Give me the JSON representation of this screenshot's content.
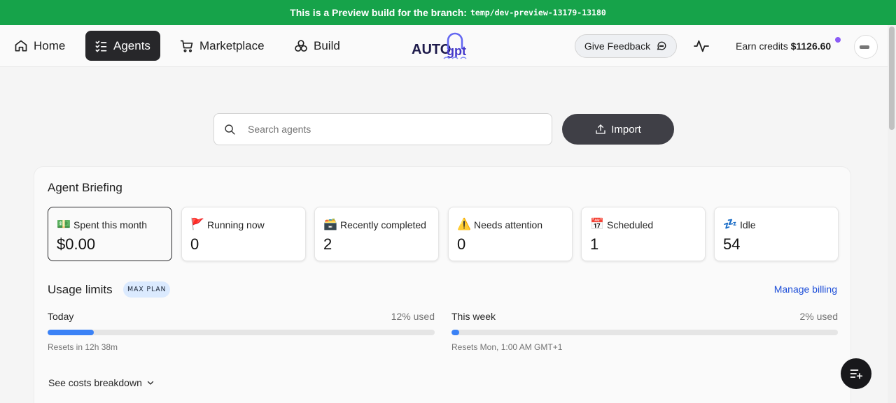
{
  "banner": {
    "text": "This is a Preview build for the branch:",
    "branch": "temp/dev-preview-13179-13180"
  },
  "nav": {
    "items": [
      {
        "label": "Home",
        "icon": "home-icon",
        "active": false
      },
      {
        "label": "Agents",
        "icon": "list-check-icon",
        "active": true
      },
      {
        "label": "Marketplace",
        "icon": "cart-icon",
        "active": false
      },
      {
        "label": "Build",
        "icon": "cubes-icon",
        "active": false
      }
    ],
    "logo_alt": "AutoGPT",
    "feedback_label": "Give Feedback",
    "credits_label": "Earn credits",
    "credits_value": "$1126.60"
  },
  "search": {
    "placeholder": "Search agents",
    "value": ""
  },
  "import_label": "Import",
  "briefing": {
    "title": "Agent Briefing",
    "stats": [
      {
        "emoji": "💵",
        "label": "Spent this month",
        "value": "$0.00"
      },
      {
        "emoji": "🚩",
        "label": "Running now",
        "value": "0"
      },
      {
        "emoji": "🗃️",
        "label": "Recently completed",
        "value": "2"
      },
      {
        "emoji": "⚠️",
        "label": "Needs attention",
        "value": "0"
      },
      {
        "emoji": "📅",
        "label": "Scheduled",
        "value": "1"
      },
      {
        "emoji": "💤",
        "label": "Idle",
        "value": "54"
      }
    ]
  },
  "usage": {
    "title": "Usage limits",
    "plan": "MAX PLAN",
    "manage_billing": "Manage billing",
    "limits": [
      {
        "label": "Today",
        "used": "12% used",
        "fraction": 0.12,
        "reset": "Resets in 12h 38m"
      },
      {
        "label": "This week",
        "used": "2% used",
        "fraction": 0.02,
        "reset": "Resets Mon, 1:00 AM GMT+1"
      }
    ]
  },
  "costs_breakdown": "See costs breakdown",
  "colors": {
    "banner": "#16a34a",
    "active_nav": "#27272a",
    "accent_link": "#1d4ed8",
    "progress": "#3b82f6",
    "notification_dot": "#8b5cf6"
  }
}
